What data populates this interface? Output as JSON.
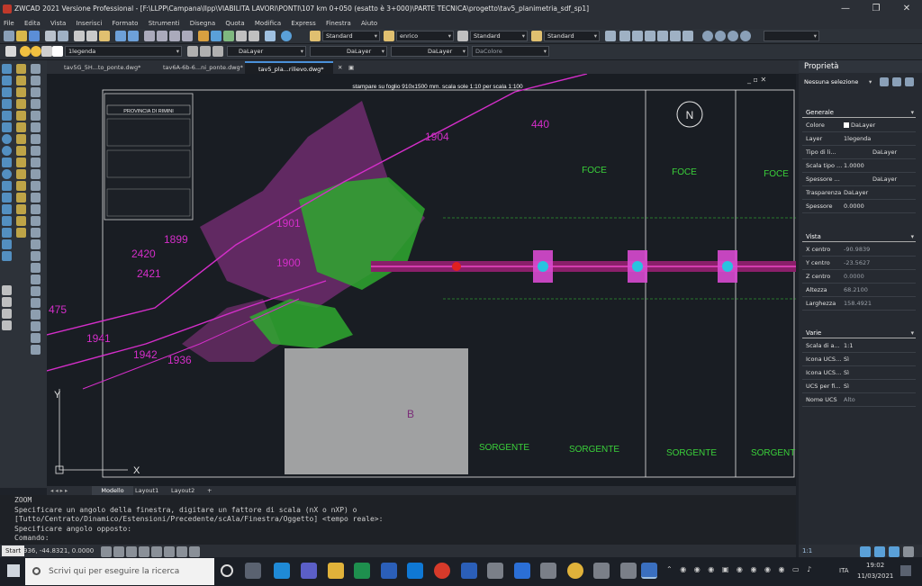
{
  "window": {
    "title": "ZWCAD 2021 Versione Professional - [F:\\LLPP\\Campana\\llpp\\VIABILITA LAVORI\\PONTI\\107 km 0+050  (esatto è 3+000)\\PARTE TECNICA\\progetto\\tav5_planimetria_sdf_sp1]",
    "minimize": "—",
    "restore": "❐",
    "close": "✕"
  },
  "menu": [
    "File",
    "Edita",
    "Vista",
    "Inserisci",
    "Formato",
    "Strumenti",
    "Disegna",
    "Quota",
    "Modifica",
    "Express",
    "Finestra",
    "Aiuto"
  ],
  "toolbar": {
    "text_style": "Standard",
    "dim_style": "enrico",
    "table_style": "Standard",
    "mleader_style": "Standard",
    "layer": "1legenda",
    "color": "DaLayer",
    "linetype": "DaLayer",
    "lineweight": "DaLayer",
    "plotstyle": "DaColore"
  },
  "tabs": [
    {
      "label": "tav5G_5H...to_ponte.dwg*"
    },
    {
      "label": "tav6A-6b-6...ni_ponte.dwg*"
    },
    {
      "label": "tav5_pla...rilievo.dwg*"
    }
  ],
  "drawing": {
    "header": "stampare su foglio 910x1500 mm. scala sole 1:10 per scala 1:100",
    "province": "PROVINCIA DI RIMINI",
    "labels": [
      "1904",
      "440",
      "1899",
      "1901",
      "2420",
      "2421",
      "1900",
      "475",
      "1941",
      "1942",
      "1936",
      "FOCE",
      "FOCE",
      "FOCE",
      "SORGENTE",
      "SORGENTE",
      "SORGENTE",
      "SORGENTE",
      "B",
      "Y",
      "X",
      "N"
    ],
    "accent": "#d42ec9"
  },
  "layout_tabs": [
    "Modello",
    "Layout1",
    "Layout2",
    "+"
  ],
  "command": {
    "lines": [
      "ZOOM",
      "Specificare un angolo della finestra, digitare un fattore di scala (nX o nXP) o",
      "[Tutto/Centrato/Dinamico/Estensioni/Precedente/scAla/Finestra/Oggetto] <tempo reale>:",
      "Specificare angolo opposto:",
      "Comando:"
    ]
  },
  "status": {
    "coords": "936, -44.8321, 0.0000",
    "start": "Start",
    "scale": "1:1"
  },
  "properties": {
    "title": "Proprietà",
    "selection": "Nessuna selezione",
    "sections": [
      {
        "name": "Generale",
        "rows": [
          {
            "k": "Colore",
            "v": "DaLayer"
          },
          {
            "k": "Layer",
            "v": "1legenda"
          },
          {
            "k": "Tipo di li...",
            "v": "DaLayer"
          },
          {
            "k": "Scala tipo ...",
            "v": "1.0000"
          },
          {
            "k": "Spessore ...",
            "v": "DaLayer"
          },
          {
            "k": "Trasparenza",
            "v": "DaLayer"
          },
          {
            "k": "Spessore",
            "v": "0.0000"
          }
        ]
      },
      {
        "name": "Vista",
        "rows": [
          {
            "k": "X centro",
            "v": "-90.9839"
          },
          {
            "k": "Y centro",
            "v": "-23.5627"
          },
          {
            "k": "Z centro",
            "v": "0.0000"
          },
          {
            "k": "Altezza",
            "v": "68.2100"
          },
          {
            "k": "Larghezza",
            "v": "158.4921"
          }
        ]
      },
      {
        "name": "Varie",
        "rows": [
          {
            "k": "Scala di a...",
            "v": "1:1"
          },
          {
            "k": "Icona UCS...",
            "v": "Sì"
          },
          {
            "k": "Icona UCS...",
            "v": "Sì"
          },
          {
            "k": "UCS per fi...",
            "v": "Sì"
          },
          {
            "k": "Nome UCS",
            "v": "Alto"
          }
        ]
      }
    ]
  },
  "taskbar": {
    "search_placeholder": "Scrivi qui per eseguire la ricerca",
    "lang": "ITA",
    "time": "19:02",
    "date": "11/03/2021"
  }
}
